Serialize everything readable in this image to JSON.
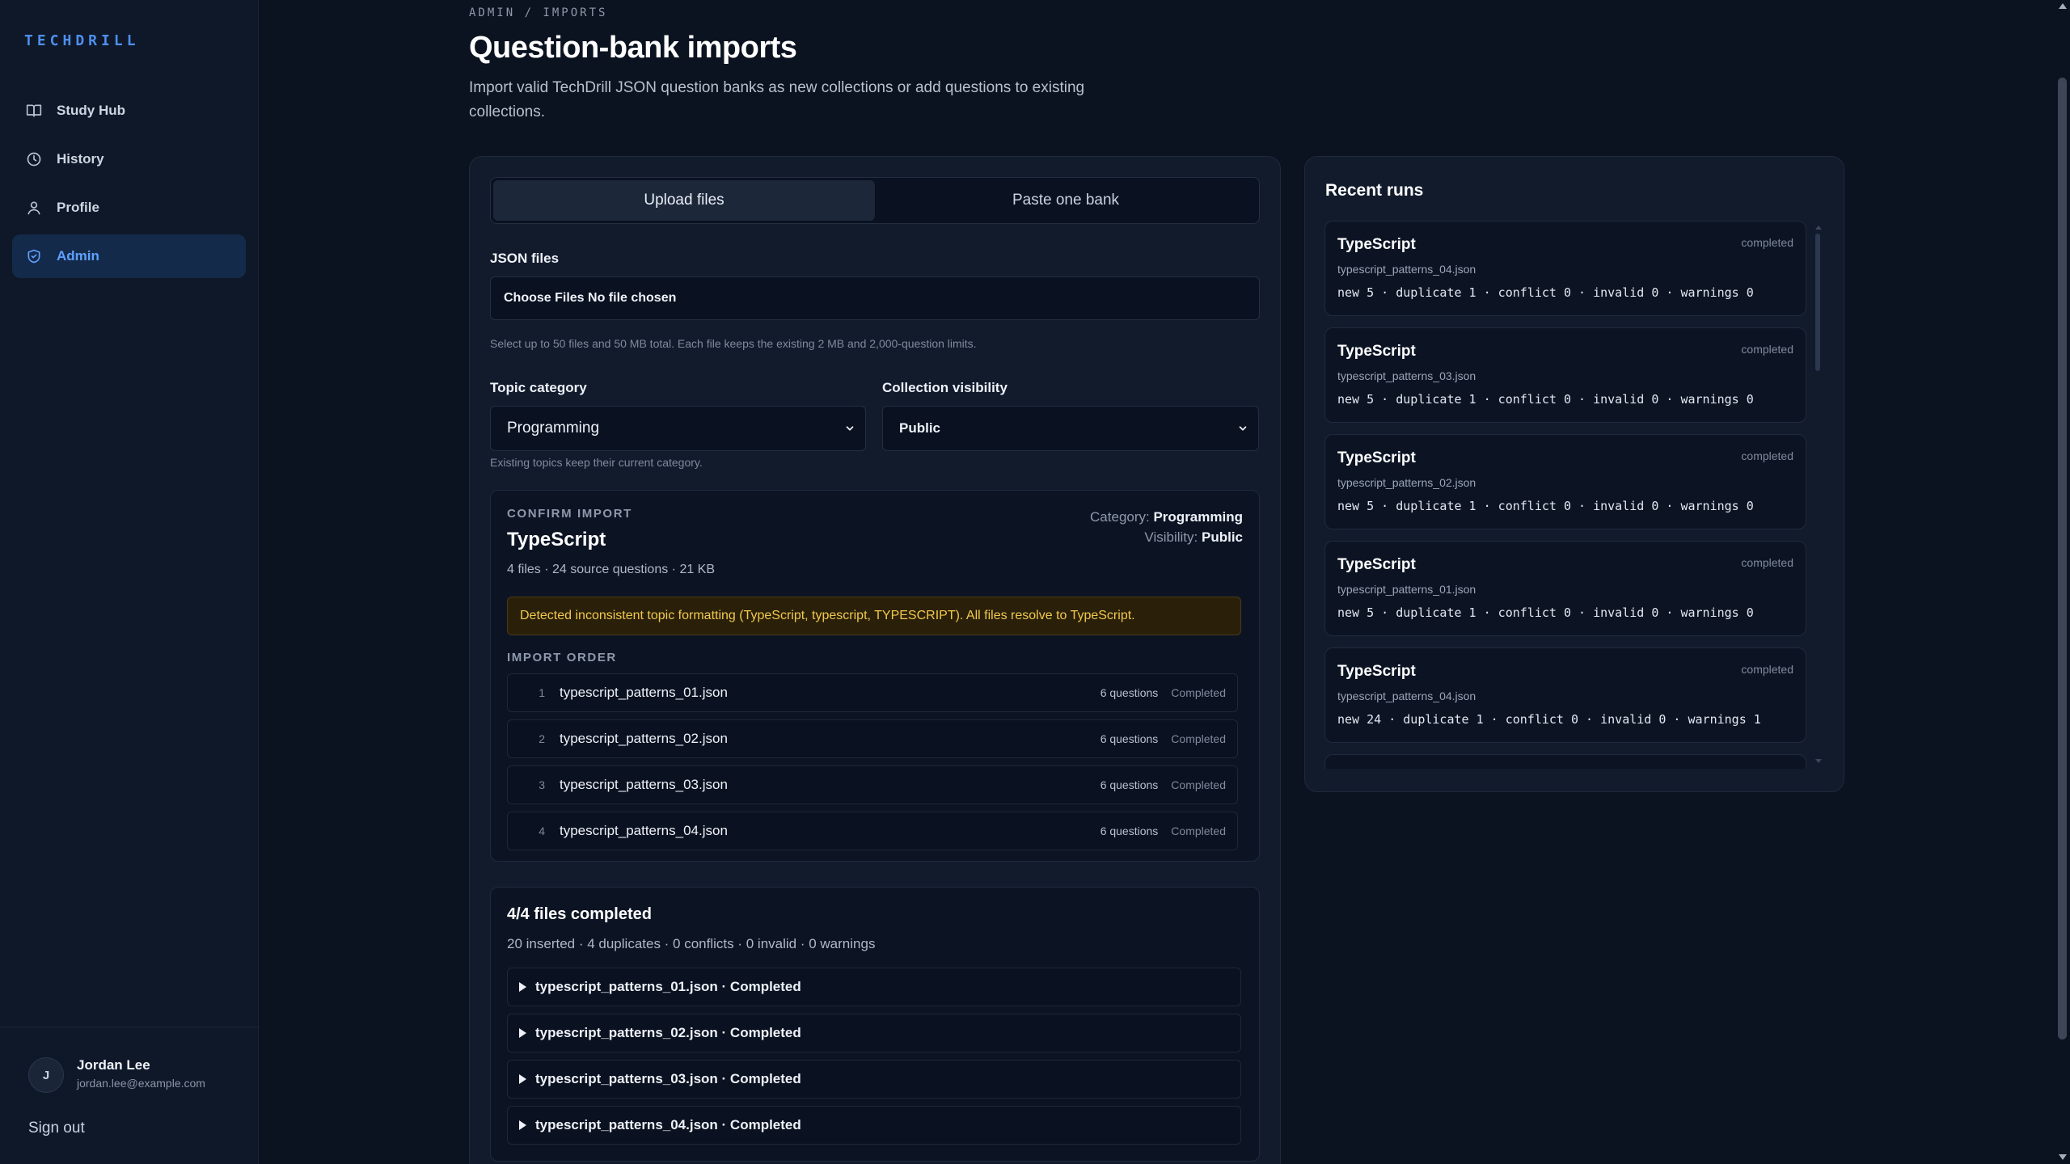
{
  "sidebar": {
    "brand": "TECHDRILL",
    "items": [
      {
        "label": "Study Hub",
        "icon": "book-icon",
        "active": false
      },
      {
        "label": "History",
        "icon": "clock-icon",
        "active": false
      },
      {
        "label": "Profile",
        "icon": "user-icon",
        "active": false
      },
      {
        "label": "Admin",
        "icon": "shield-icon",
        "active": true
      }
    ],
    "user": {
      "initial": "J",
      "name": "Jordan Lee",
      "email": "jordan.lee@example.com"
    },
    "sign_out": "Sign out"
  },
  "header": {
    "breadcrumb": "ADMIN / IMPORTS",
    "title": "Question-bank imports",
    "description": "Import valid TechDrill JSON question banks as new collections or add questions to existing collections."
  },
  "importer": {
    "tabs": [
      {
        "label": "Upload files",
        "active": true
      },
      {
        "label": "Paste one bank",
        "active": false
      }
    ],
    "json_files_label": "JSON files",
    "file_input_text": "Choose Files No file chosen",
    "file_hint": "Select up to 50 files and 50 MB total. Each file keeps the existing 2 MB and 2,000-question limits.",
    "topic_category_label": "Topic category",
    "topic_category_value": "Programming",
    "visibility_label": "Collection visibility",
    "visibility_value": "Public",
    "category_hint": "Existing topics keep their current category.",
    "confirm": {
      "kicker": "CONFIRM IMPORT",
      "title": "TypeScript",
      "meta": "4 files · 24 source questions · 21 KB",
      "category_label": "Category:",
      "category_value": "Programming",
      "visibility_label": "Visibility:",
      "visibility_value": "Public",
      "warning": "Detected inconsistent topic formatting (TypeScript, typescript, TYPESCRIPT). All files resolve to TypeScript.",
      "order_label": "IMPORT ORDER",
      "order": [
        {
          "num": "1",
          "file": "typescript_patterns_01.json",
          "questions": "6 questions",
          "status": "Completed"
        },
        {
          "num": "2",
          "file": "typescript_patterns_02.json",
          "questions": "6 questions",
          "status": "Completed"
        },
        {
          "num": "3",
          "file": "typescript_patterns_03.json",
          "questions": "6 questions",
          "status": "Completed"
        },
        {
          "num": "4",
          "file": "typescript_patterns_04.json",
          "questions": "6 questions",
          "status": "Completed"
        }
      ]
    },
    "results": {
      "title": "4/4 files completed",
      "summary": "20 inserted · 4 duplicates · 0 conflicts · 0 invalid · 0 warnings",
      "rows": [
        {
          "label": "typescript_patterns_01.json · Completed"
        },
        {
          "label": "typescript_patterns_02.json · Completed"
        },
        {
          "label": "typescript_patterns_03.json · Completed"
        },
        {
          "label": "typescript_patterns_04.json · Completed"
        }
      ]
    }
  },
  "recent_runs": {
    "title": "Recent runs",
    "runs": [
      {
        "topic": "TypeScript",
        "status": "completed",
        "file": "typescript_patterns_04.json",
        "stats": "new 5 · duplicate 1 · conflict 0 · invalid 0 · warnings 0"
      },
      {
        "topic": "TypeScript",
        "status": "completed",
        "file": "typescript_patterns_03.json",
        "stats": "new 5 · duplicate 1 · conflict 0 · invalid 0 · warnings 0"
      },
      {
        "topic": "TypeScript",
        "status": "completed",
        "file": "typescript_patterns_02.json",
        "stats": "new 5 · duplicate 1 · conflict 0 · invalid 0 · warnings 0"
      },
      {
        "topic": "TypeScript",
        "status": "completed",
        "file": "typescript_patterns_01.json",
        "stats": "new 5 · duplicate 1 · conflict 0 · invalid 0 · warnings 0"
      },
      {
        "topic": "TypeScript",
        "status": "completed",
        "file": "typescript_patterns_04.json",
        "stats": "new 24 · duplicate 1 · conflict 0 · invalid 0 · warnings 1"
      }
    ]
  },
  "colors": {
    "accent": "#5fa0ff",
    "background": "#0b1220",
    "warning_text": "#f2c94c",
    "warning_bg": "#2a200a"
  }
}
